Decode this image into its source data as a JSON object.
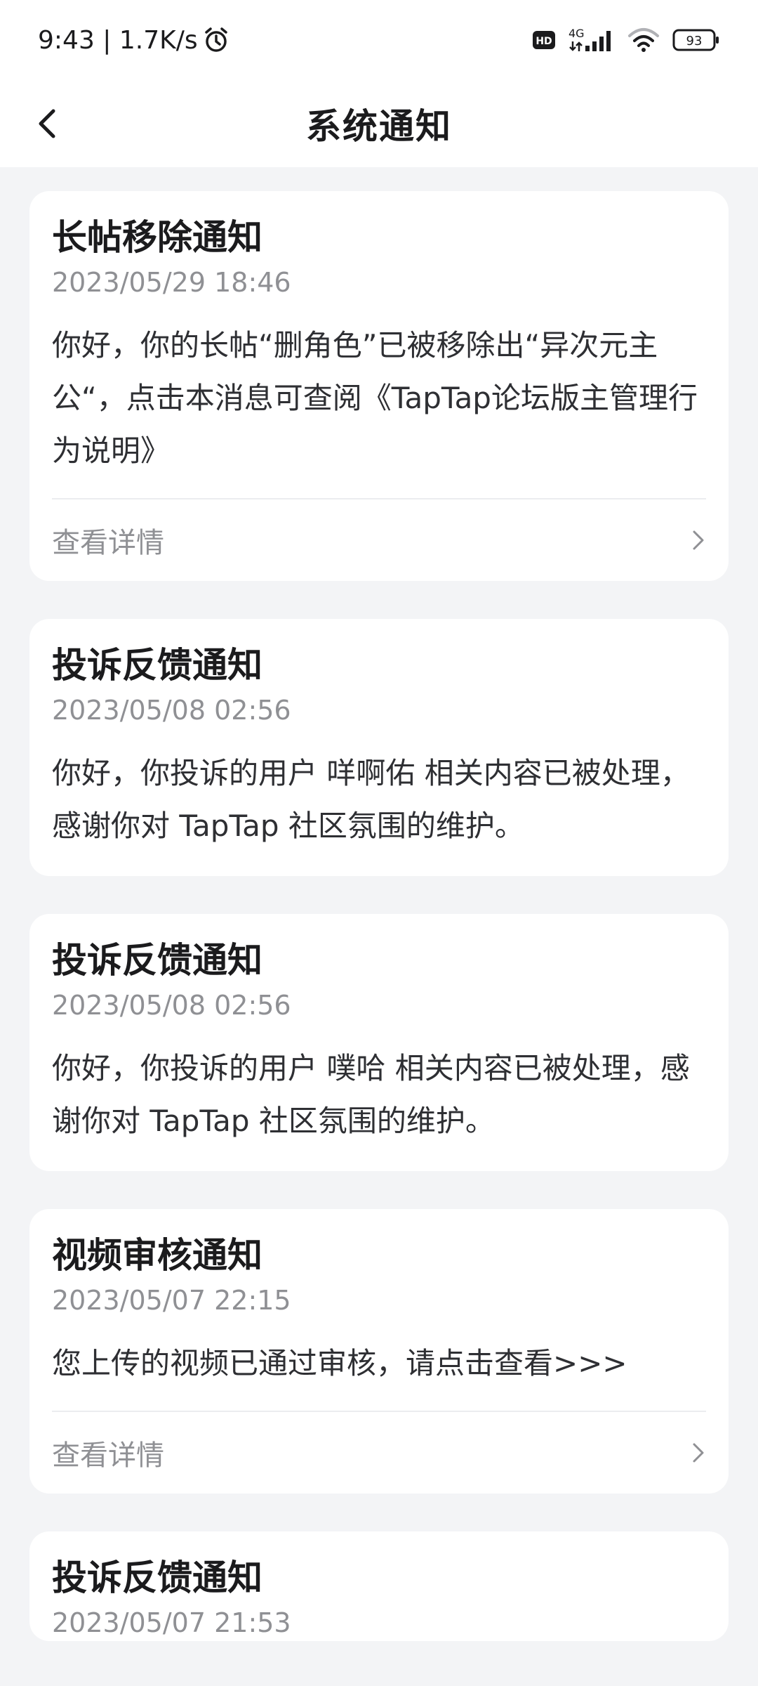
{
  "status_bar": {
    "time_speed": "9:43 | 1.7K/s",
    "icons": [
      "alarm-icon",
      "hd-icon",
      "signal-4g-icon",
      "wifi-icon",
      "battery-icon"
    ],
    "network": "4G",
    "hd_badge": "HD",
    "battery": "93"
  },
  "header": {
    "title": "系统通知",
    "back_icon": "back-arrow-icon"
  },
  "notifications": [
    {
      "title": "长帖移除通知",
      "time": "2023/05/29 18:46",
      "body": "你好，你的长帖“删角色”已被移除出“异次元主公“，点击本消息可查阅《TapTap论坛版主管理行为说明》",
      "footer": "查看详情"
    },
    {
      "title": "投诉反馈通知",
      "time": "2023/05/08 02:56",
      "body": "你好，你投诉的用户 咩啊佑 相关内容已被处理，感谢你对 TapTap 社区氛围的维护。"
    },
    {
      "title": "投诉反馈通知",
      "time": "2023/05/08 02:56",
      "body": "你好，你投诉的用户 噗哈 相关内容已被处理，感谢你对 TapTap 社区氛围的维护。"
    },
    {
      "title": "视频审核通知",
      "time": "2023/05/07 22:15",
      "body": "您上传的视频已通过审核，请点击查看>>>",
      "footer": "查看详情"
    },
    {
      "title": "投诉反馈通知",
      "time": "2023/05/07 21:53"
    }
  ],
  "colors": {
    "page_bg": "#f3f4f6",
    "card_bg": "#ffffff",
    "title_text": "#1b1b1d",
    "secondary_text": "#8f9094",
    "body_text": "#2e2f33"
  }
}
